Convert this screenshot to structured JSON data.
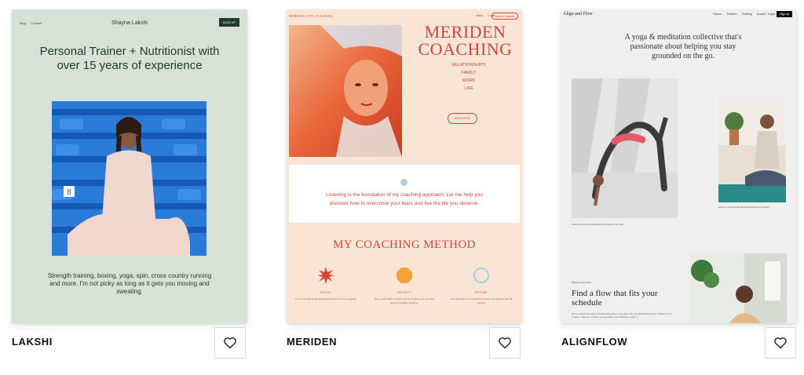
{
  "cards": [
    {
      "name": "LAKSHI",
      "preview": {
        "nav": {
          "links": [
            "Blog",
            "Contact"
          ],
          "brand": "Shayna Lakshi",
          "signup": "SIGN UP"
        },
        "headline": "Personal Trainer + Nutritionist with over 15 years of experience",
        "body": "Strength training, boxing, yoga, spin, cross country running and more. I'm not picky as long as it gets you moving and sweating."
      },
      "colors": {
        "background": "#d7e1d8",
        "text": "#1e3a2b"
      }
    },
    {
      "name": "MERIDEN",
      "preview": {
        "nav": {
          "logo": "MERIDEN LIFE COACHING",
          "menu": [
            "Menu",
            "Login"
          ],
          "book": "Book A Session"
        },
        "title": "MERIDEN COACHING",
        "topics": [
          "RELATIONSHIPS",
          "FAMILY",
          "WORK",
          "LIFE"
        ],
        "cta": "BOOK NOW",
        "quote": "Listening is the foundation of my coaching approach. Let me help you discover how to overcome your fears and live the life you deserve.",
        "method_title": "MY COACHING METHOD",
        "steps": [
          {
            "label": "FOCUS",
            "desc": "It's time to start by identifying the focus of our time together"
          },
          {
            "label": "REFLECT",
            "desc": "Next, you'll reflect on what may be blocking you, and we'll look for possible solutions"
          },
          {
            "label": "REFINE",
            "desc": "Your final step is to continuously refine your path as your life evolves"
          }
        ]
      },
      "colors": {
        "background": "#f8e5d5",
        "accent": "#c9463a"
      }
    },
    {
      "name": "ALIGNFLOW",
      "preview": {
        "nav": {
          "logo": "Align and Flow",
          "menu": [
            "Classes",
            "Teachers",
            "Training",
            "Journal"
          ],
          "login": "Login",
          "signup": "Sign up"
        },
        "intro": "A yoga & meditation collective that's passionate about helping you stay grounded on the go.",
        "caption1": "Mariela Ayu practicing Backbends with Danae in her studio",
        "caption2": "Instructor Jordan leading Morning Meditation Flow Basic",
        "eyebrow": "Discover practice",
        "find": "Find a flow that fits your schedule",
        "small": "We've created three types of membership plans to best align with your individual practice. Whether you're looking to improve on basic yoga principles, gain unlimited access to a"
      },
      "colors": {
        "background": "#efefef"
      }
    }
  ],
  "favorite_icon": "heart-outline-icon"
}
